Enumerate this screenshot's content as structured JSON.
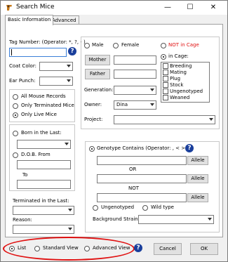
{
  "window": {
    "title": "Search Mice",
    "minimize": "—",
    "maximize": "☐",
    "close": "✕"
  },
  "tabs": [
    "Basic Information",
    "Advanced"
  ],
  "tag_number": {
    "label": "Tag Number: (Operator: *, ?, - )",
    "value": ""
  },
  "coat_color": {
    "label": "Coat Color:",
    "value": ""
  },
  "ear_punch": {
    "label": "Ear Punch:",
    "value": ""
  },
  "mouse_records": {
    "options": [
      "All Mouse Records",
      "Only Terminated Mice",
      "Only Live Mice"
    ],
    "selected": "Only Live Mice"
  },
  "born": {
    "label": "Born in the Last:",
    "value": ""
  },
  "dob": {
    "label": "D.O.B. From",
    "to_label": "To",
    "from_value": "",
    "to_value": ""
  },
  "terminated": {
    "label": "Terminated in the Last:",
    "value": ""
  },
  "reason": {
    "label": "Reason:",
    "value": ""
  },
  "sex": {
    "male": "Male",
    "female": "Female"
  },
  "mother": {
    "label": "Mother",
    "value": ""
  },
  "father": {
    "label": "Father",
    "value": ""
  },
  "generation": {
    "label": "Generation:",
    "value": ""
  },
  "owner": {
    "label": "Owner:",
    "value": "Dina"
  },
  "project": {
    "label": "Project:",
    "value": ""
  },
  "cage": {
    "not_in_cage": "NOT in Cage",
    "in_cage": "in Cage:",
    "not_in_cage_color": "#e01010"
  },
  "cage_types": [
    "Breeding",
    "Mating",
    "Plug",
    "Stock",
    "Ungenotyped",
    "Weaned"
  ],
  "genotype": {
    "label": "Genotype Contains  (Operator: , < >)",
    "allele": "Allele",
    "or": "OR",
    "not": "NOT",
    "ungenotyped": "Ungenotyped",
    "wild_type": "Wild type"
  },
  "background_strain": {
    "label": "Background Strain:",
    "value": ""
  },
  "views": [
    "List",
    "Standard View",
    "Advanced View"
  ],
  "selected_view": "List",
  "help_glyph": "?",
  "buttons": {
    "cancel": "Cancel",
    "ok": "OK"
  },
  "icons": {
    "app": "search-mice-app-icon",
    "help": "help-icon"
  },
  "colors": {
    "help_bg": "#1a3f9c",
    "focus_border": "#3c7fd8",
    "highlight_oval": "#e01010"
  }
}
